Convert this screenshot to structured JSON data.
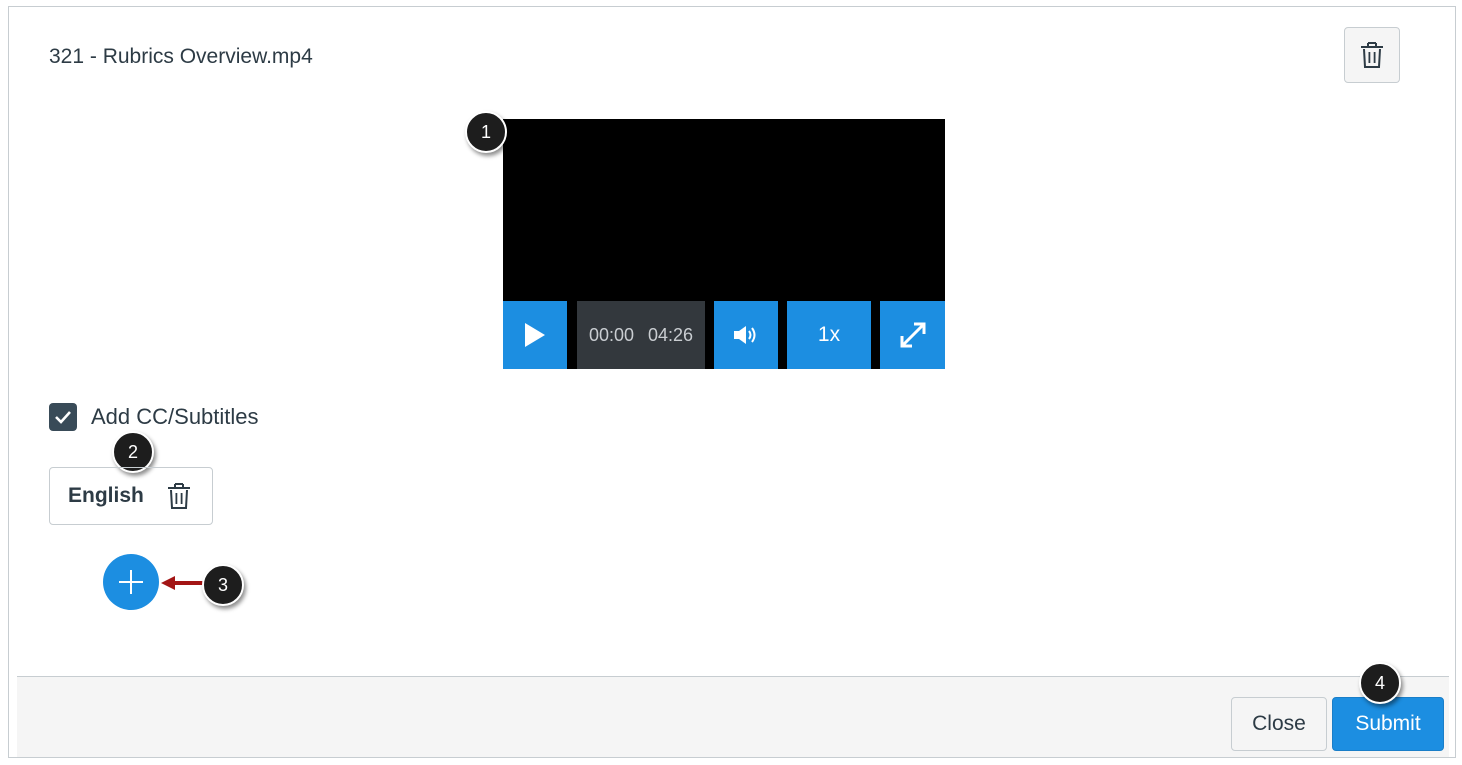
{
  "dialog": {
    "file_name": "321 - Rubrics Overview.mp4",
    "delete_icon": "trash-icon"
  },
  "player": {
    "play_icon": "play-icon",
    "time_current": "00:00",
    "time_total": "04:26",
    "volume_icon": "volume-icon",
    "speed_label": "1x",
    "fullscreen_icon": "fullscreen-icon"
  },
  "captions": {
    "checkbox_checked": true,
    "checkbox_label": "Add CC/Subtitles",
    "language": "English",
    "remove_icon": "trash-icon",
    "add_icon": "plus-icon"
  },
  "callouts": [
    "1",
    "2",
    "3",
    "4"
  ],
  "footer": {
    "close_label": "Close",
    "submit_label": "Submit"
  },
  "colors": {
    "accent": "#1c8ee1",
    "callout": "#1d1d1d",
    "arrow": "#a31515",
    "text": "#2d3b45"
  }
}
